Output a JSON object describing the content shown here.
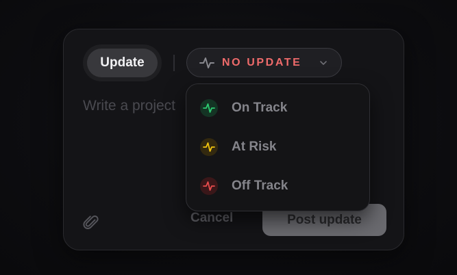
{
  "composer": {
    "tab_label": "Update",
    "placeholder": "Write a project",
    "cancel_label": "Cancel",
    "post_label": "Post update"
  },
  "status_select": {
    "value": "NO UPDATE",
    "value_color": "#ef6b6b",
    "icon": "pulse-icon"
  },
  "status_menu": {
    "items": [
      {
        "label": "On Track",
        "icon": "pulse-icon",
        "color": "#2ecc71"
      },
      {
        "label": "At Risk",
        "icon": "pulse-icon",
        "color": "#f1c40f"
      },
      {
        "label": "Off Track",
        "icon": "pulse-icon",
        "color": "#e74c4c"
      }
    ]
  }
}
